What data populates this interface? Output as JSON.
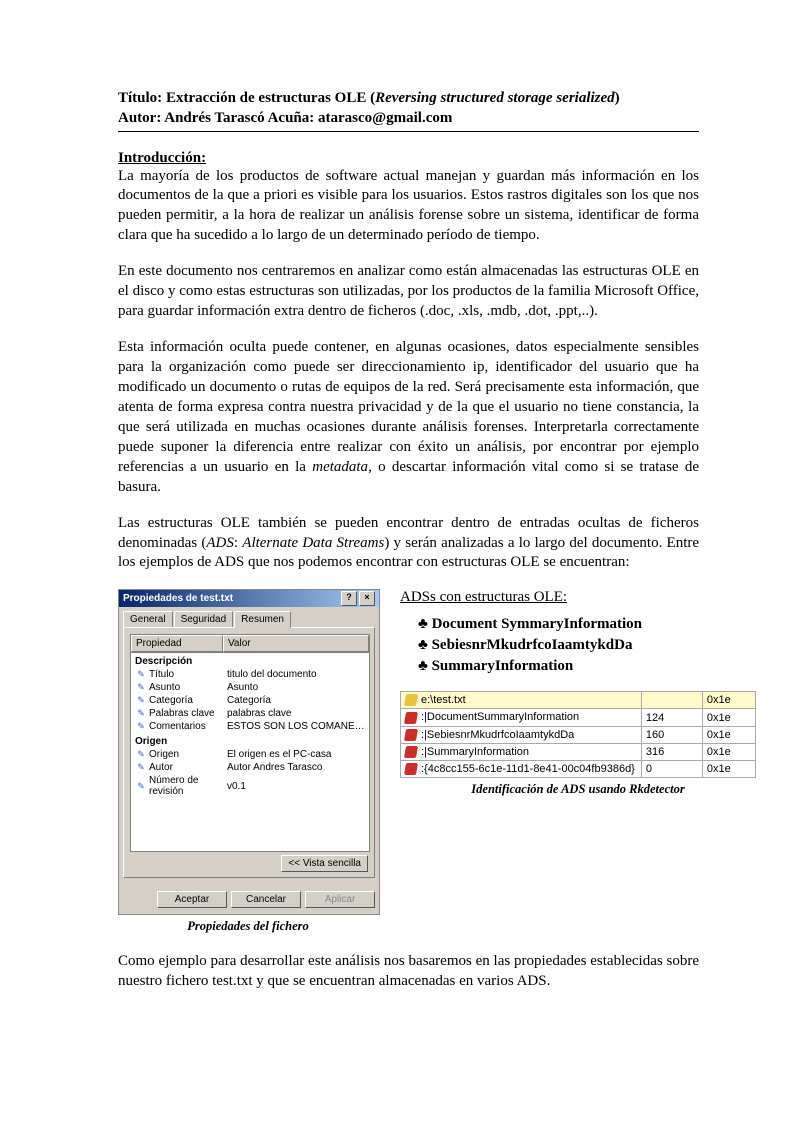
{
  "header": {
    "titulo_label": "Título: ",
    "titulo_main": "Extracción de estructuras OLE (",
    "titulo_sub": "Reversing structured storage serialized",
    "titulo_close": ")",
    "autor_line": "Autor: Andrés Tarascó Acuña: atarasco@gmail.com"
  },
  "intro_heading": "Introducción:",
  "paras": {
    "p1": "La mayoría de los productos de software actual manejan y guardan más información en los documentos de la que a priori es visible para los usuarios. Estos rastros digitales son los que nos pueden permitir, a la hora de realizar un análisis forense sobre un sistema, identificar de forma clara que ha sucedido a lo largo de un determinado período de tiempo.",
    "p2": "En este documento nos centraremos en analizar como están almacenadas las estructuras OLE en el disco y como estas estructuras son utilizadas, por los productos de la familia Microsoft Office, para guardar información extra dentro de ficheros (.doc, .xls, .mdb, .dot, .ppt,..).",
    "p3a": "Esta información oculta puede contener, en algunas ocasiones, datos especialmente sensibles para la organización como puede ser direccionamiento ip, identificador del usuario que ha modificado un documento o rutas de equipos de la red.  Será precisamente esta información, que atenta de forma expresa contra nuestra privacidad y de la que el usuario no tiene constancia, la que será utilizada en muchas ocasiones durante análisis forenses. Interpretarla correctamente puede suponer la diferencia entre realizar con éxito un análisis, por encontrar por ejemplo referencias a un usuario en la ",
    "p3_em": "metadata",
    "p3b": ", o descartar información vital como si se tratase de basura.",
    "p4a": "Las estructuras OLE también se pueden encontrar dentro de entradas ocultas de ficheros denominadas (",
    "p4_em1": "ADS",
    "p4b": ": ",
    "p4_em2": "Alternate Data Streams",
    "p4c": ") y serán analizadas a lo largo del documento. Entre los ejemplos de ADS que nos podemos encontrar con estructuras OLE se encuentran:",
    "p5": "Como ejemplo para desarrollar este análisis nos basaremos en las propiedades establecidas sobre nuestro fichero test.txt y que se encuentran almacenadas en varios ADS."
  },
  "dialog": {
    "title": "Propiedades de test.txt",
    "help": "?",
    "close": "×",
    "tabs": {
      "general": "General",
      "seguridad": "Seguridad",
      "resumen": "Resumen"
    },
    "headers": {
      "prop": "Propiedad",
      "val": "Valor"
    },
    "sections": [
      {
        "section": "Descripción"
      },
      {
        "icon": "✎",
        "name": "Título",
        "value": "titulo del documento"
      },
      {
        "icon": "✎",
        "name": "Asunto",
        "value": "Asunto"
      },
      {
        "icon": "✎",
        "name": "Categoría",
        "value": "Categoría"
      },
      {
        "icon": "✎",
        "name": "Palabras clave",
        "value": "palabras clave"
      },
      {
        "icon": "✎",
        "name": "Comentarios",
        "value": "ESTOS SON LOS COMANETARIOS S..."
      },
      {
        "section": "Origen"
      },
      {
        "icon": "✎",
        "name": "Origen",
        "value": "El origen es el PC-casa"
      },
      {
        "icon": "✎",
        "name": "Autor",
        "value": "Autor Andres Tarasco"
      },
      {
        "icon": "✎",
        "name": "Número de revisión",
        "value": "v0.1"
      }
    ],
    "vista_sencilla": "<< Vista sencilla",
    "buttons": {
      "aceptar": "Aceptar",
      "cancelar": "Cancelar",
      "aplicar": "Aplicar"
    },
    "caption": "Propiedades del fichero"
  },
  "ads": {
    "heading": "ADSs con estructuras OLE:",
    "items": [
      "♣ Document SymmaryInformation",
      "♣ SebiesnrMkudrfcoIaamtykdDa",
      "♣ SummaryInformation"
    ]
  },
  "rk": {
    "rows": [
      {
        "ico": "y",
        "path": "e:\\test.txt",
        "size": "",
        "code": "0x1e"
      },
      {
        "ico": "r",
        "path": ":|DocumentSummaryInformation",
        "size": "124",
        "code": "0x1e"
      },
      {
        "ico": "r",
        "path": ":|SebiesnrMkudrfcoIaamtykdDa",
        "size": "160",
        "code": "0x1e"
      },
      {
        "ico": "r",
        "path": ":|SummaryInformation",
        "size": "316",
        "code": "0x1e"
      },
      {
        "ico": "r",
        "path": ":{4c8cc155-6c1e-11d1-8e41-00c04fb9386d}",
        "size": "0",
        "code": "0x1e"
      }
    ],
    "caption": "Identificación de ADS usando Rkdetector"
  }
}
